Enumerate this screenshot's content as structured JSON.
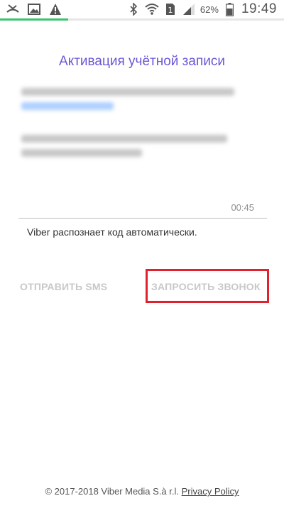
{
  "status_bar": {
    "battery": "62%",
    "time": "19:49",
    "sim_label": "1",
    "left_icons": [
      "missed-call-icon",
      "image-icon",
      "warning-icon"
    ],
    "right_icons": [
      "bluetooth-icon",
      "wifi-icon",
      "sim-icon",
      "signal-icon",
      "battery-icon"
    ]
  },
  "progress": {
    "fraction": 0.24,
    "color": "#3cc36a"
  },
  "page": {
    "title": "Активация учётной записи",
    "timer": "00:45",
    "hint": "Viber распознает код автоматически."
  },
  "actions": {
    "send_sms": "ОТПРАВИТЬ SMS",
    "request_call": "ЗАПРОСИТЬ ЗВОНОК"
  },
  "footer": {
    "copyright": "© 2017-2018 Viber Media S.à r.l.",
    "privacy": "Privacy Policy"
  },
  "colors": {
    "accent": "#6b57d6",
    "highlight": "#e0222c",
    "disabled": "#c8c8c8"
  }
}
